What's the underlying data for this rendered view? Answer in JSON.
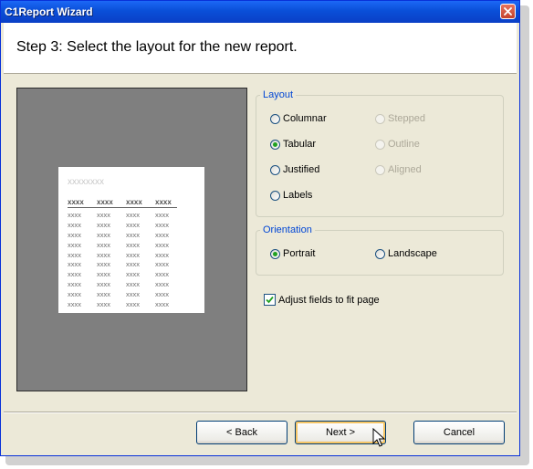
{
  "window": {
    "title": "C1Report Wizard"
  },
  "header": {
    "step_title": "Step 3: Select the layout for the new report."
  },
  "preview": {
    "title_placeholder": "xxxxxxxx",
    "column_headers": [
      "xxxx",
      "xxxx",
      "xxxx",
      "xxxx"
    ],
    "rows": [
      [
        "xxxx",
        "xxxx",
        "xxxx",
        "xxxx"
      ],
      [
        "xxxx",
        "xxxx",
        "xxxx",
        "xxxx"
      ],
      [
        "xxxx",
        "xxxx",
        "xxxx",
        "xxxx"
      ],
      [
        "xxxx",
        "xxxx",
        "xxxx",
        "xxxx"
      ],
      [
        "xxxx",
        "xxxx",
        "xxxx",
        "xxxx"
      ],
      [
        "xxxx",
        "xxxx",
        "xxxx",
        "xxxx"
      ],
      [
        "xxxx",
        "xxxx",
        "xxxx",
        "xxxx"
      ],
      [
        "xxxx",
        "xxxx",
        "xxxx",
        "xxxx"
      ],
      [
        "xxxx",
        "xxxx",
        "xxxx",
        "xxxx"
      ],
      [
        "xxxx",
        "xxxx",
        "xxxx",
        "xxxx"
      ]
    ]
  },
  "layout_group": {
    "legend": "Layout",
    "options": [
      {
        "label": "Columnar",
        "checked": false,
        "enabled": true
      },
      {
        "label": "Tabular",
        "checked": true,
        "enabled": true
      },
      {
        "label": "Justified",
        "checked": false,
        "enabled": true
      },
      {
        "label": "Labels",
        "checked": false,
        "enabled": true
      },
      {
        "label": "Stepped",
        "checked": false,
        "enabled": false
      },
      {
        "label": "Outline",
        "checked": false,
        "enabled": false
      },
      {
        "label": "Aligned",
        "checked": false,
        "enabled": false
      }
    ]
  },
  "orientation_group": {
    "legend": "Orientation",
    "options": [
      {
        "label": "Portrait",
        "checked": true
      },
      {
        "label": "Landscape",
        "checked": false
      }
    ]
  },
  "adjust_fields": {
    "label": "Adjust fields to fit page",
    "checked": true
  },
  "buttons": {
    "back": "< Back",
    "next": "Next >",
    "cancel": "Cancel"
  },
  "colors": {
    "title_bar": "#0a4fd8",
    "dialog_bg": "#ece9d8",
    "group_legend": "#0046d5",
    "radio_dot": "#21a121",
    "disabled_text": "#aca899"
  }
}
